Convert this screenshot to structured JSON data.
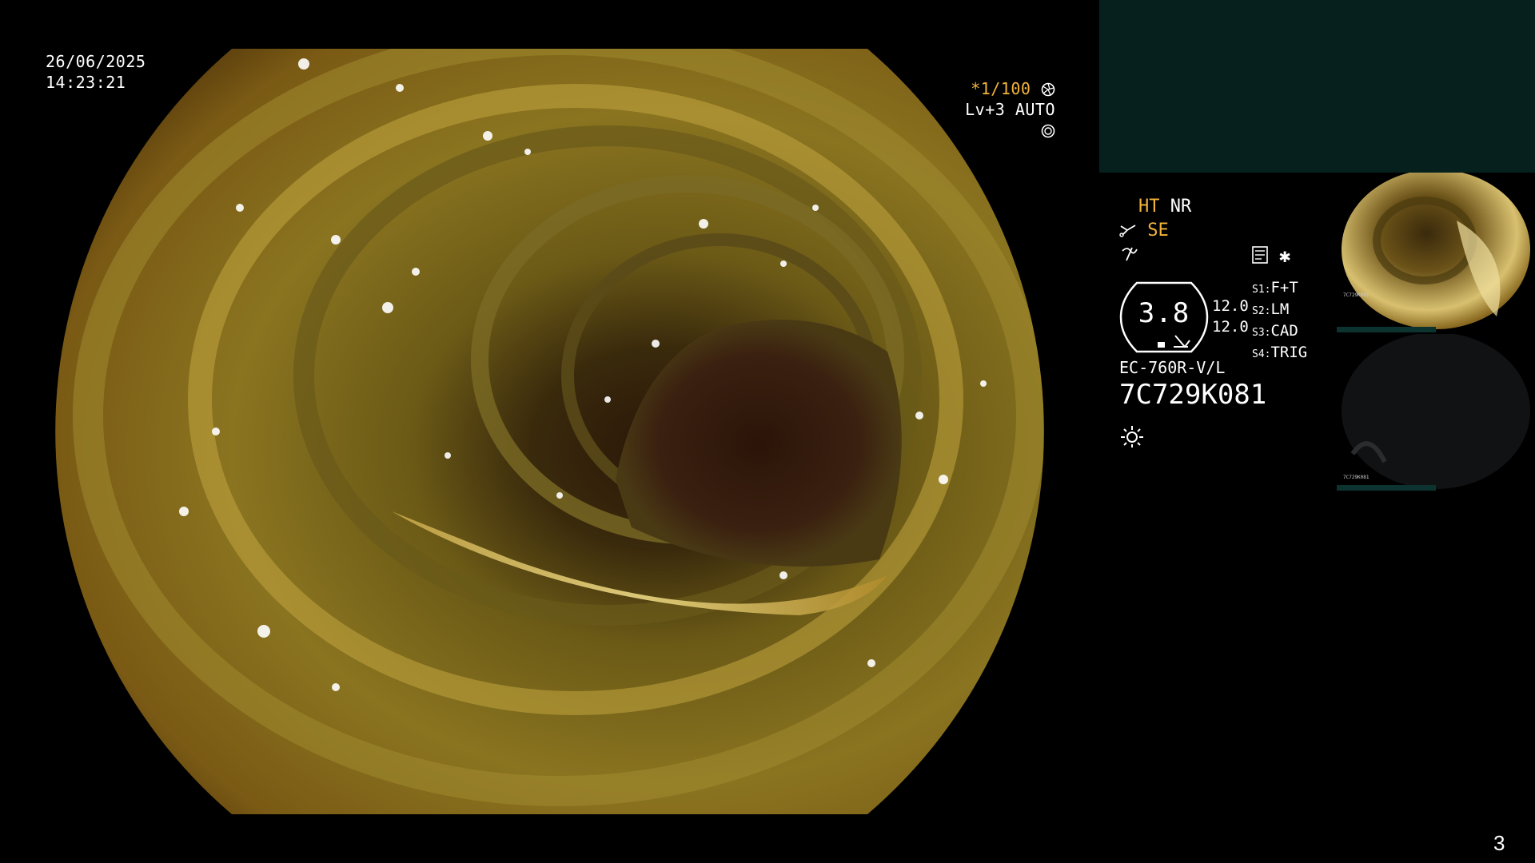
{
  "timestamp": {
    "date": "26/06/2025",
    "time": "14:23:21"
  },
  "exposure": {
    "shutter": "*1/100",
    "level": "Lv+3 AUTO"
  },
  "modes": {
    "ht": "HT",
    "nr": "NR",
    "se": "SE"
  },
  "scope_info": {
    "value": "3.8",
    "reading_1": "12.0",
    "reading_2": "12.0",
    "model": "EC-760R-V/L",
    "serial": "7C729K081"
  },
  "switches": [
    {
      "key": "S1:",
      "value": "F+T"
    },
    {
      "key": "S2:",
      "value": "LM"
    },
    {
      "key": "S3:",
      "value": "CAD"
    },
    {
      "key": "S4:",
      "value": "TRIG"
    }
  ],
  "thumb_labels": {
    "code": "7C729K081"
  },
  "page_number": "3",
  "colors": {
    "accent": "#f2b43a",
    "panel": "#06201d",
    "background": "#000000"
  },
  "icons": [
    "aperture-icon",
    "iris-icon",
    "scissors-icon",
    "zigzag-icon",
    "document-icon",
    "asterisk-icon",
    "sun-icon"
  ]
}
